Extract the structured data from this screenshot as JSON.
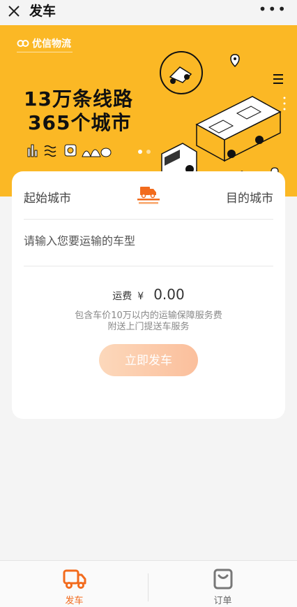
{
  "nav": {
    "title": "发车",
    "more": "•••"
  },
  "banner": {
    "brand": "优信物流",
    "headline_line1": "13万条线路",
    "headline_line2": "365个城市"
  },
  "form": {
    "start_city": "起始城市",
    "end_city": "目的城市",
    "car_type_placeholder": "请输入您要运输的车型",
    "fee_label": "运费",
    "fee_currency": "¥",
    "fee_amount": "0.00",
    "note_line1": "包含车价10万以内的运输保障服务费",
    "note_line2": "附送上门提送车服务",
    "submit_label": "立即发车"
  },
  "tabs": [
    {
      "label": "发车",
      "active": true
    },
    {
      "label": "订单",
      "active": false
    }
  ],
  "colors": {
    "banner_bg": "#fbb825",
    "accent": "#f26b1d",
    "button_gradient_start": "#fcd8bb",
    "button_gradient_end": "#fbbf9c"
  }
}
